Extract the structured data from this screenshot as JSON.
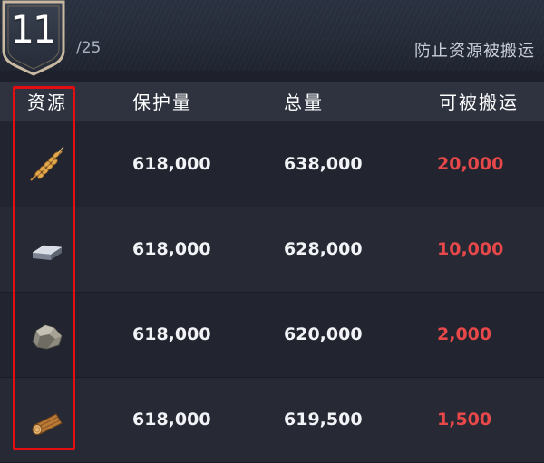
{
  "header": {
    "level": "11",
    "level_max": "/25",
    "title": "防止资源被搬运"
  },
  "table": {
    "columns": [
      "资源",
      "保护量",
      "总量",
      "可被搬运"
    ],
    "rows": [
      {
        "resource_icon": "wheat-icon",
        "protected": "618,000",
        "total": "638,000",
        "movable": "20,000"
      },
      {
        "resource_icon": "iron-ingot-icon",
        "protected": "618,000",
        "total": "628,000",
        "movable": "10,000"
      },
      {
        "resource_icon": "stone-icon",
        "protected": "618,000",
        "total": "620,000",
        "movable": "2,000"
      },
      {
        "resource_icon": "wood-log-icon",
        "protected": "618,000",
        "total": "619,500",
        "movable": "1,500"
      }
    ]
  },
  "colors": {
    "movable_text": "#e8484a",
    "highlight_box": "#e50d14",
    "shield_border": "#c9b9a0"
  }
}
